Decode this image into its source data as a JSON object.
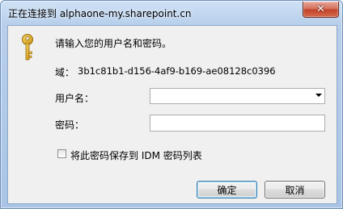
{
  "window": {
    "title": "正在连接到 alphaone-my.sharepoint.cn",
    "close_symbol": "✕"
  },
  "dialog": {
    "prompt": "请输入您的用户名和密码。",
    "domain_label": "域：",
    "domain_value": "3b1c81b1-d156-4af9-b169-ae08128c0396",
    "username_label": "用户名：",
    "username_value": "",
    "password_label": "密码：",
    "password_value": "",
    "save_checkbox_label": "将此密码保存到 IDM 密码列表",
    "save_checked": false,
    "ok_label": "确定",
    "cancel_label": "取消"
  },
  "icons": {
    "key": "key-icon",
    "close": "close-icon",
    "dropdown": "chevron-down-icon"
  },
  "colors": {
    "title_gradient_top": "#cfe1f5",
    "title_gradient_bottom": "#a9c4e6",
    "close_red": "#c1432a",
    "panel_bg": "#f0f0f0",
    "key_gold": "#e0b030"
  }
}
